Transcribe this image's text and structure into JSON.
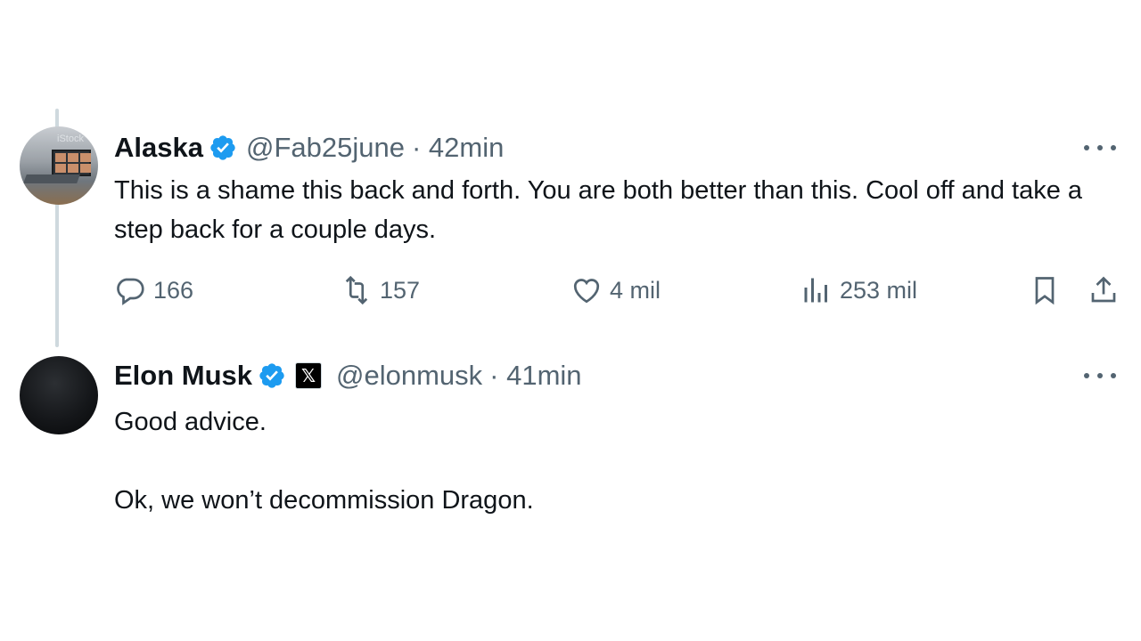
{
  "thread": [
    {
      "author": {
        "name": "Alaska",
        "handle": "@Fab25june",
        "time": "· 42min",
        "avatar": "laptop-photo-avatar",
        "avatar_watermark": "iStock",
        "verified": true
      },
      "text": "This is a shame this back and forth. You are both better than this. Cool off and take a step back for a couple days.",
      "stats": {
        "replies": "166",
        "reposts": "157",
        "likes": "4 mil",
        "views": "253 mil"
      },
      "icons": [
        "reply-icon",
        "repost-icon",
        "like-icon",
        "views-icon",
        "bookmark-icon",
        "share-icon",
        "more-icon"
      ]
    },
    {
      "author": {
        "name": "Elon Musk",
        "handle": "@elonmusk",
        "time": "· 41min",
        "avatar": "dark-avatar",
        "verified": true,
        "affiliate_badge": "𝕏"
      },
      "text": "Good advice.\n\nOk, we won’t decommission Dragon.",
      "icons": [
        "more-icon"
      ]
    }
  ],
  "colors": {
    "text": "#0f1419",
    "secondary": "#536471",
    "verified": "#1d9bf0",
    "thread_line": "#cfd9de"
  }
}
